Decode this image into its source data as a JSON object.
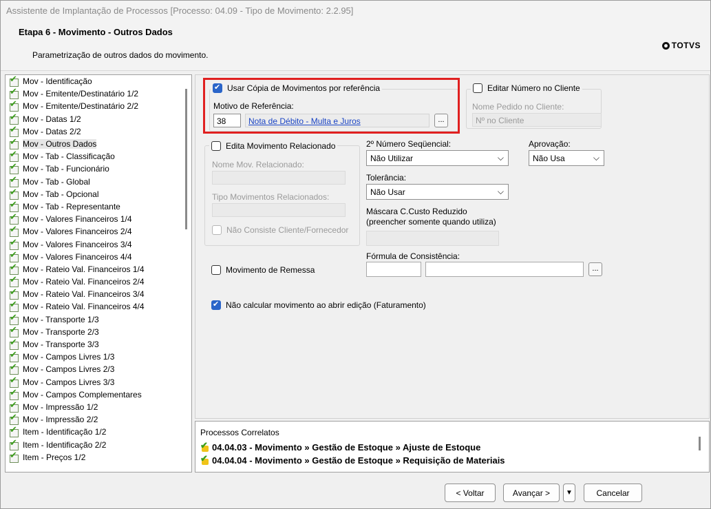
{
  "window": {
    "title": "Assistente de Implantação de Processos [Processo: 04.09 - Tipo de Movimento: 2.2.95]"
  },
  "header": {
    "step_title": "Etapa 6 - Movimento - Outros Dados",
    "step_subtitle": "Parametrização de outros dados do movimento.",
    "logo_text": "TOTVS"
  },
  "tree": {
    "selected_index": 5,
    "items": [
      "Mov - Identificação",
      "Mov - Emitente/Destinatário 1/2",
      "Mov - Emitente/Destinatário 2/2",
      "Mov - Datas 1/2",
      "Mov - Datas 2/2",
      "Mov - Outros Dados",
      "Mov - Tab - Classificação",
      "Mov - Tab - Funcionário",
      "Mov - Tab - Global",
      "Mov - Tab - Opcional",
      "Mov - Tab - Representante",
      "Mov - Valores Financeiros 1/4",
      "Mov - Valores Financeiros 2/4",
      "Mov - Valores Financeiros 3/4",
      "Mov - Valores Financeiros 4/4",
      "Mov - Rateio Val. Financeiros 1/4",
      "Mov - Rateio Val. Financeiros 2/4",
      "Mov - Rateio Val. Financeiros 3/4",
      "Mov - Rateio Val. Financeiros 4/4",
      "Mov - Transporte 1/3",
      "Mov - Transporte 2/3",
      "Mov - Transporte 3/3",
      "Mov - Campos Livres 1/3",
      "Mov - Campos Livres 2/3",
      "Mov - Campos Livres 3/3",
      "Mov - Campos Complementares",
      "Mov - Impressão 1/2",
      "Mov - Impressão 2/2",
      "Item - Identificação 1/2",
      "Item - Identificação 2/2",
      "Item - Preços 1/2"
    ]
  },
  "form": {
    "usar_copia": {
      "label": "Usar Cópia de Movimentos por referência",
      "checked": true
    },
    "motivo_label": "Motivo de Referência:",
    "motivo_code": "38",
    "motivo_desc": "Nota de Débito - Multa e Juros",
    "dots": "...",
    "editar_numero": {
      "label": "Editar Número no Cliente",
      "checked": false
    },
    "nome_pedido_label": "Nome Pedido no Cliente:",
    "nome_pedido_value": "Nº no Cliente",
    "edita_mov": {
      "label": "Edita Movimento Relacionado",
      "checked": false
    },
    "nome_mov_label": "Nome Mov. Relacionado:",
    "tipo_mov_label": "Tipo Movimentos Relacionados:",
    "nao_consiste": {
      "label": "Não Consiste Cliente/Fornecedor",
      "checked": false
    },
    "segundo_numero_label": "2º Número Seqüencial:",
    "segundo_numero_value": "Não Utilizar",
    "aprovacao_label": "Aprovação:",
    "aprovacao_value": "Não Usa",
    "tolerancia_label": "Tolerância:",
    "tolerancia_value": "Não Usar",
    "mascara_label_1": "Máscara C.Custo Reduzido",
    "mascara_label_2": "(preencher somente quando utiliza)",
    "formula_label": "Fórmula de Consistência:",
    "remessa": {
      "label": "Movimento de Remessa",
      "checked": false
    },
    "nao_calcular": {
      "label": "Não calcular movimento ao abrir edição (Faturamento)",
      "checked": true
    }
  },
  "correlatos": {
    "title": "Processos Correlatos",
    "items": [
      "04.04.03 - Movimento » Gestão de Estoque » Ajuste de Estoque",
      "04.04.04 - Movimento » Gestão de Estoque » Requisição de Materiais"
    ]
  },
  "footer": {
    "voltar": "< Voltar",
    "avancar": "Avançar >",
    "dropdown": "▼",
    "cancelar": "Cancelar"
  },
  "icons": [
    "check-doc-icon",
    "chevron-down-icon",
    "totvs-logo-icon"
  ]
}
